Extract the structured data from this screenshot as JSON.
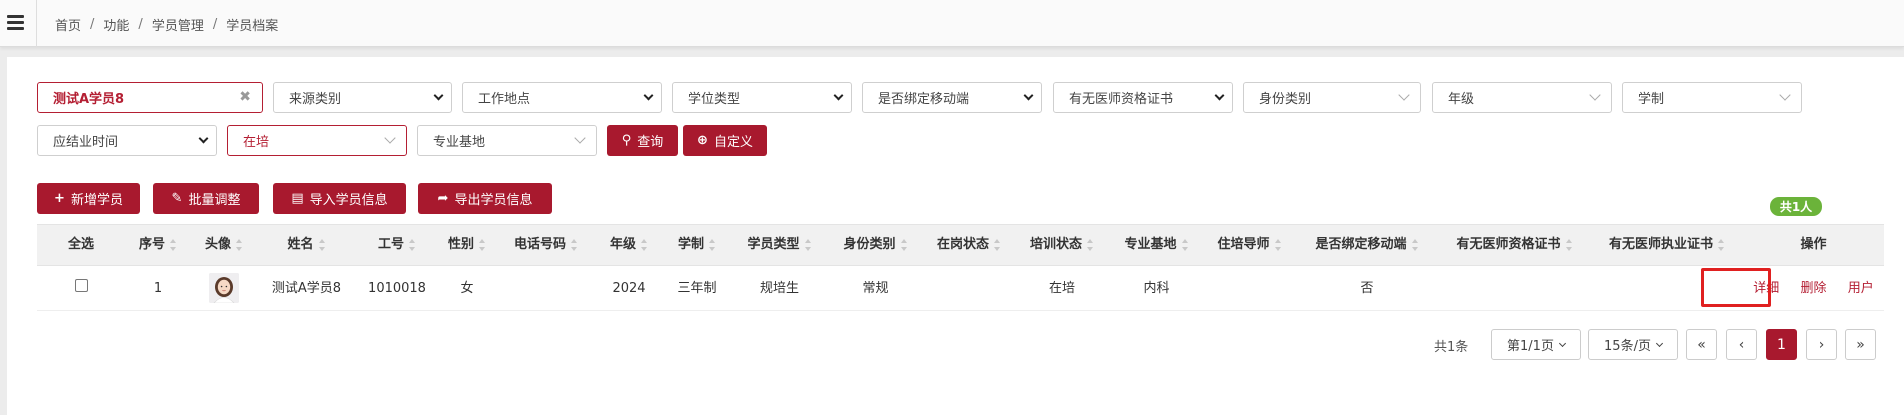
{
  "breadcrumb": [
    "首页",
    "功能",
    "学员管理",
    "学员档案"
  ],
  "filters": {
    "name_value": "测试A学员8",
    "row1": [
      "来源类别",
      "工作地点",
      "学位类型",
      "是否绑定移动端",
      "有无医师资格证书",
      "身份类别",
      "年级",
      "学制"
    ],
    "grad_time": "应结业时间",
    "status_value": "在培",
    "base_placeholder": "专业基地",
    "query_label": "查询",
    "custom_label": "自定义"
  },
  "toolbar": {
    "add_label": "新增学员",
    "batch_label": "批量调整",
    "import_label": "导入学员信息",
    "export_label": "导出学员信息"
  },
  "count_badge": "共1人",
  "table": {
    "headers": [
      "全选",
      "序号",
      "头像",
      "姓名",
      "工号",
      "性别",
      "电话号码",
      "年级",
      "学制",
      "学员类型",
      "身份类别",
      "在岗状态",
      "培训状态",
      "专业基地",
      "住培导师",
      "是否绑定移动端",
      "有无医师资格证书",
      "有无医师执业证书",
      "操作"
    ],
    "row": {
      "index": "1",
      "name": "测试A学员8",
      "staff_no": "1010018",
      "gender": "女",
      "phone": "",
      "grade": "2024",
      "system": "三年制",
      "type": "规培生",
      "identity": "常规",
      "job_status": "",
      "train_status": "在培",
      "base": "内科",
      "mentor": "",
      "mobile_bound": "否",
      "qual_cert": "",
      "prac_cert": "",
      "op_detail": "详细",
      "op_delete": "删除",
      "op_user": "用户"
    }
  },
  "pagination": {
    "total": "共1条",
    "page_select": "第1/1页",
    "size_select": "15条/页",
    "first": "«",
    "prev": "‹",
    "current": "1",
    "next": "›",
    "last": "»"
  },
  "colors": {
    "accent": "#a8192e",
    "badge_green": "#6bb33a",
    "highlight": "#e02020"
  }
}
